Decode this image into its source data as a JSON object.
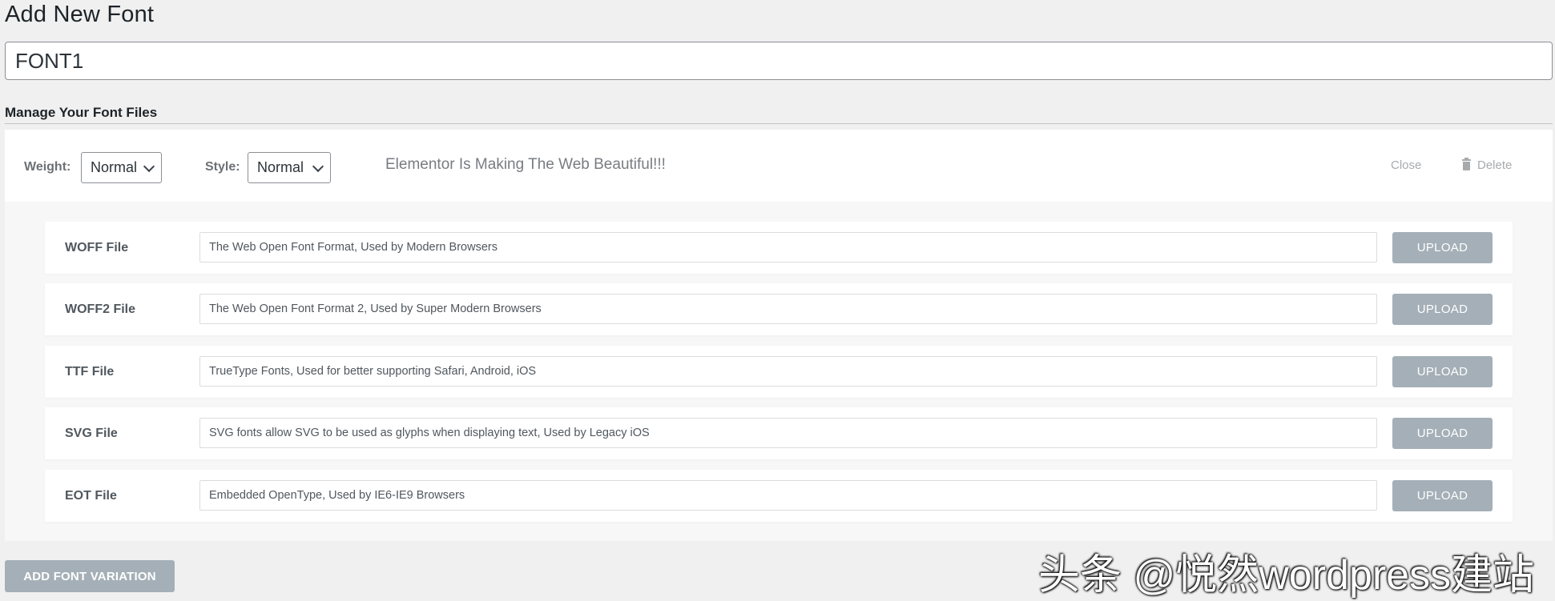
{
  "page": {
    "title": "Add New Font",
    "font_name_value": "FONT1"
  },
  "manage": {
    "heading": "Manage Your Font Files"
  },
  "variation": {
    "weight_label": "Weight:",
    "weight_value": "Normal",
    "style_label": "Style:",
    "style_value": "Normal",
    "preview_text": "Elementor Is Making The Web Beautiful!!!",
    "close_label": "Close",
    "delete_label": "Delete",
    "files": [
      {
        "label": "WOFF File",
        "placeholder": "The Web Open Font Format, Used by Modern Browsers",
        "button": "UPLOAD"
      },
      {
        "label": "WOFF2 File",
        "placeholder": "The Web Open Font Format 2, Used by Super Modern Browsers",
        "button": "UPLOAD"
      },
      {
        "label": "TTF File",
        "placeholder": "TrueType Fonts, Used for better supporting Safari, Android, iOS",
        "button": "UPLOAD"
      },
      {
        "label": "SVG File",
        "placeholder": "SVG fonts allow SVG to be used as glyphs when displaying text, Used by Legacy iOS",
        "button": "UPLOAD"
      },
      {
        "label": "EOT File",
        "placeholder": "Embedded OpenType, Used by IE6-IE9 Browsers",
        "button": "UPLOAD"
      }
    ]
  },
  "actions": {
    "add_variation": "ADD FONT VARIATION"
  },
  "watermark": "头条 @悦然wordpress建站",
  "colors": {
    "background": "#f0f0f1",
    "button_gray": "#a4afb7"
  }
}
